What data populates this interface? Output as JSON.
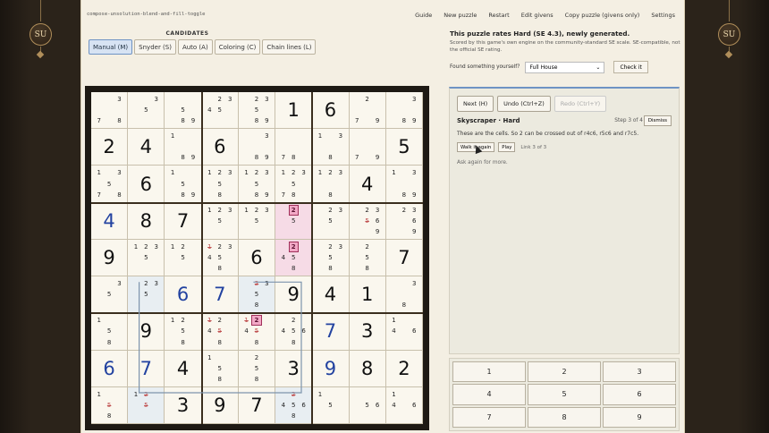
{
  "brand": {
    "left_logo": "SU",
    "right_logo": "SU"
  },
  "topbar": {
    "mode_text": "compose-unsolution-blend-and-fill-toggle",
    "nav": [
      "Guide",
      "New puzzle",
      "Restart",
      "Edit givens",
      "Copy puzzle (givens only)",
      "Settings"
    ]
  },
  "candidates": {
    "label": "CANDIDATES",
    "buttons": [
      "Manual (M)",
      "Snyder (S)",
      "Auto (A)",
      "Coloring (C)",
      "Chain lines (L)"
    ],
    "active": "Manual (M)"
  },
  "rating": {
    "headline": "This puzzle rates Hard (SE 4.3), newly generated.",
    "sub": "Scored by this game's own engine on the community-standard SE scale. SE-compatible, not the official SE rating."
  },
  "found": {
    "label": "Found something yourself?",
    "selected": "Full House",
    "check": "Check it"
  },
  "panel": {
    "next": "Next (H)",
    "undo": "Undo (Ctrl+Z)",
    "redo": "Redo (Ctrl+Y)",
    "title": "Skyscraper · Hard",
    "step": "Step 3 of 4",
    "dismiss": "Dismiss",
    "desc": "These are the cells. So 2 can be crossed out of r4c6, r5c6 and r7c5.",
    "walk": "Walk it again",
    "play": "Play",
    "link": "Link 3 of 3",
    "ask": "Ask again for more."
  },
  "numpad": [
    "1",
    "2",
    "3",
    "4",
    "5",
    "6",
    "7",
    "8",
    "9"
  ],
  "colors": {
    "given_blue": "#2242a0",
    "highlight_pink": "#f2a8c6",
    "accent": "#6f93c4"
  },
  "board": [
    [
      {
        "c": [
          "",
          "",
          "3",
          "",
          "",
          "",
          "7",
          "",
          "8"
        ]
      },
      {
        "c": [
          "",
          "",
          "3",
          "",
          "5",
          "",
          "",
          "",
          ""
        ]
      },
      {
        "c": [
          "",
          "",
          "",
          "",
          "5",
          "",
          "",
          "8",
          "9"
        ]
      },
      {
        "c": [
          "",
          "2",
          "3",
          "4",
          "5",
          "",
          "",
          "",
          ""
        ]
      },
      {
        "c": [
          "",
          "2",
          "3",
          "",
          "5",
          "",
          "",
          "8",
          "9"
        ]
      },
      {
        "v": "1"
      },
      {
        "v": "6"
      },
      {
        "c": [
          "",
          "2",
          "",
          "",
          "",
          "",
          "7",
          "",
          "9"
        ]
      },
      {
        "c": [
          "",
          "",
          "3",
          "",
          "",
          "",
          "",
          "8",
          "9"
        ]
      }
    ],
    [
      {
        "v": "2"
      },
      {
        "v": "4"
      },
      {
        "c": [
          "1",
          "",
          "",
          "",
          "",
          "",
          "",
          "8",
          "9"
        ]
      },
      {
        "v": "6"
      },
      {
        "c": [
          "",
          "",
          "3",
          "",
          "",
          "",
          "",
          "8",
          "9"
        ]
      },
      {
        "c": [
          "",
          "",
          "",
          "",
          "",
          "",
          "7",
          "8",
          ""
        ]
      },
      {
        "c": [
          "1",
          "",
          "3",
          "",
          "",
          "",
          "",
          "8",
          ""
        ]
      },
      {
        "c": [
          "",
          "",
          "",
          "",
          "",
          "",
          "7",
          "",
          "9"
        ]
      },
      {
        "v": "5"
      }
    ],
    [
      {
        "c": [
          "1",
          "",
          "3",
          "",
          "5",
          "",
          "7",
          "",
          "8"
        ]
      },
      {
        "v": "6"
      },
      {
        "c": [
          "1",
          "",
          "",
          "",
          "5",
          "",
          "",
          "8",
          "9"
        ]
      },
      {
        "c": [
          "1",
          "2",
          "3",
          "",
          "5",
          "",
          "",
          "8",
          ""
        ]
      },
      {
        "c": [
          "1",
          "2",
          "3",
          "",
          "5",
          "",
          "",
          "8",
          "9"
        ]
      },
      {
        "c": [
          "1",
          "2",
          "3",
          "",
          "5",
          "",
          "7",
          "8",
          ""
        ]
      },
      {
        "c": [
          "1",
          "2",
          "3",
          "",
          "",
          "",
          "",
          "8",
          ""
        ]
      },
      {
        "v": "4"
      },
      {
        "c": [
          "1",
          "",
          "3",
          "",
          "",
          "",
          "",
          "8",
          "9"
        ]
      }
    ],
    [
      {
        "v": "4",
        "b": 1
      },
      {
        "v": "8"
      },
      {
        "v": "7"
      },
      {
        "c": [
          "1",
          "2",
          "3",
          "",
          "5",
          "",
          "",
          "",
          ""
        ]
      },
      {
        "c": [
          "1",
          "2",
          "3",
          "",
          "5",
          "",
          "",
          "",
          ""
        ]
      },
      {
        "c": [
          "",
          "2h",
          "",
          "",
          "5",
          "",
          "",
          "",
          ""
        ]
      },
      {
        "c": [
          "",
          "2",
          "3",
          "",
          "5",
          "",
          "",
          "",
          ""
        ]
      },
      {
        "c": [
          "",
          "2",
          "3",
          "",
          "5x",
          "6",
          "",
          "",
          "9"
        ]
      },
      {
        "c": [
          "",
          "2",
          "3",
          "",
          "",
          "6",
          "",
          "",
          "9"
        ]
      }
    ],
    [
      {
        "v": "9"
      },
      {
        "c": [
          "1",
          "2",
          "3",
          "",
          "5",
          "",
          "",
          "",
          ""
        ]
      },
      {
        "c": [
          "1",
          "2",
          "",
          "",
          "5",
          "",
          "",
          "",
          ""
        ]
      },
      {
        "c": [
          "1x",
          "2",
          "3",
          "4",
          "5",
          "",
          "",
          "8",
          ""
        ]
      },
      {
        "v": "6"
      },
      {
        "c": [
          "",
          "2h",
          "",
          "4",
          "5",
          "",
          "",
          "8",
          ""
        ]
      },
      {
        "c": [
          "",
          "2",
          "3",
          "",
          "5",
          "",
          "",
          "8",
          ""
        ]
      },
      {
        "c": [
          "",
          "2",
          "",
          "",
          "5",
          "",
          "",
          "8",
          ""
        ]
      },
      {
        "v": "7"
      }
    ],
    [
      {
        "c": [
          "",
          "",
          "3",
          "",
          "5",
          "",
          "",
          "",
          ""
        ]
      },
      {
        "c": [
          "",
          "2",
          "3",
          "",
          "5",
          "",
          "",
          "",
          ""
        ],
        "s": 1
      },
      {
        "v": "6",
        "b": 1
      },
      {
        "v": "7",
        "b": 1
      },
      {
        "c": [
          "",
          "2x",
          "3",
          "",
          "5",
          "",
          "",
          "8",
          ""
        ],
        "s": 1
      },
      {
        "v": "9"
      },
      {
        "v": "4"
      },
      {
        "v": "1"
      },
      {
        "c": [
          "",
          "",
          "3",
          "",
          "",
          "",
          "",
          "8",
          ""
        ]
      }
    ],
    [
      {
        "c": [
          "1",
          "",
          "",
          "",
          "5",
          "",
          "",
          "8",
          ""
        ]
      },
      {
        "v": "9"
      },
      {
        "c": [
          "1",
          "2",
          "",
          "",
          "5",
          "",
          "",
          "8",
          ""
        ]
      },
      {
        "c": [
          "1x",
          "2",
          "",
          "4",
          "5x",
          "",
          "",
          "8",
          ""
        ]
      },
      {
        "c": [
          "1x",
          "2h",
          "",
          "4",
          "5x",
          "",
          "",
          "8",
          ""
        ]
      },
      {
        "c": [
          "",
          "2",
          "",
          "4",
          "5",
          "6",
          "",
          "8",
          ""
        ]
      },
      {
        "v": "7",
        "b": 1
      },
      {
        "v": "3"
      },
      {
        "c": [
          "1",
          "",
          "",
          "4",
          "",
          "6",
          "",
          "",
          ""
        ]
      }
    ],
    [
      {
        "v": "6",
        "b": 1
      },
      {
        "v": "7",
        "b": 1
      },
      {
        "v": "4"
      },
      {
        "c": [
          "1",
          "",
          "",
          "",
          "5",
          "",
          "",
          "8",
          ""
        ]
      },
      {
        "c": [
          "",
          "2",
          "",
          "",
          "5",
          "",
          "",
          "8",
          ""
        ]
      },
      {
        "v": "3"
      },
      {
        "v": "9",
        "b": 1
      },
      {
        "v": "8"
      },
      {
        "v": "2"
      }
    ],
    [
      {
        "c": [
          "1",
          "",
          "",
          "",
          "5x",
          "",
          "",
          "8",
          ""
        ]
      },
      {
        "c": [
          "1",
          "2x",
          "",
          "",
          "5x",
          "",
          "",
          "",
          ""
        ],
        "s": 1
      },
      {
        "v": "3"
      },
      {
        "v": "9"
      },
      {
        "v": "7"
      },
      {
        "c": [
          "",
          "2x",
          "",
          "4",
          "5",
          "6",
          "",
          "8",
          ""
        ],
        "s": 1
      },
      {
        "c": [
          "1",
          "",
          "",
          "",
          "5",
          "",
          "",
          "",
          ""
        ]
      },
      {
        "c": [
          "",
          "",
          "",
          "",
          "5",
          "6",
          "",
          "",
          ""
        ]
      },
      {
        "c": [
          "1",
          "",
          "",
          "4",
          "",
          "6",
          "",
          "",
          ""
        ]
      }
    ]
  ]
}
